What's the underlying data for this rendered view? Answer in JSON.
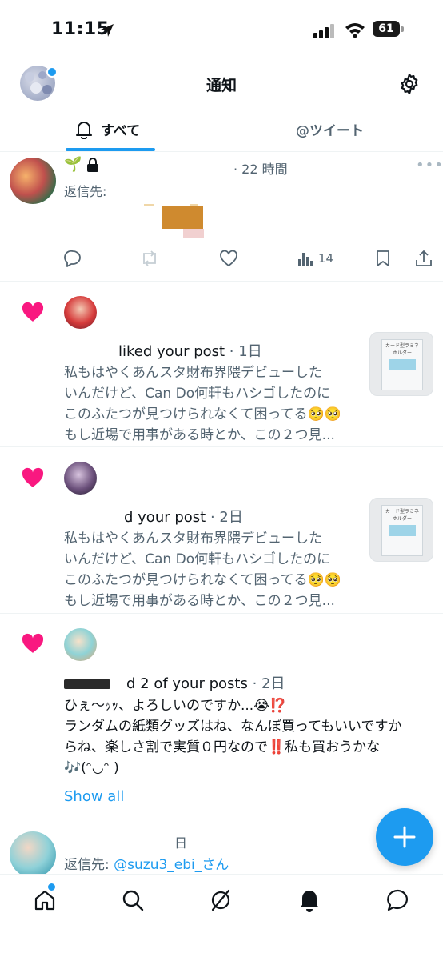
{
  "status_bar": {
    "time": "11:15",
    "battery": "61"
  },
  "header": {
    "title": "通知"
  },
  "tabs": [
    {
      "label": "すべて",
      "active": true
    },
    {
      "label": "@ツイート",
      "active": false
    }
  ],
  "notifications": [
    {
      "type": "reply",
      "time": "· 22 時間",
      "reply_to": "返信先:",
      "views": "14"
    },
    {
      "type": "like",
      "action_text": "liked your post",
      "time": " · 1日",
      "post_lines": [
        "私もはやくあんスタ財布界隈デビューした",
        "いんだけど、Can Do何軒もハシゴしたのに",
        "このふたつが見つけられなくて困ってる🥺🥺",
        "もし近場で用事がある時とか、この２つ見..."
      ],
      "thumb_label": "カード型ラミネホルダー"
    },
    {
      "type": "like",
      "action_text": "d your post",
      "time": " · 2日",
      "post_lines": [
        "私もはやくあんスタ財布界隈デビューした",
        "いんだけど、Can Do何軒もハシゴしたのに",
        "このふたつが見つけられなくて困ってる🥺🥺",
        "もし近場で用事がある時とか、この２つ見..."
      ],
      "thumb_label": "カード型ラミネホルダー"
    },
    {
      "type": "like",
      "action_text": "d 2 of your posts",
      "time": " · 2日",
      "post_lines": [
        "ひぇ〜ｯｯ、よろしいのですか...😭⁉️",
        "ランダムの紙類グッズはね、なんぼ買ってもいいですか",
        "らね、楽しさ割で実質０円なので‼️私も買おうかな",
        "🎶(ᵔ◡ᵔ )"
      ],
      "show_all": "Show all"
    },
    {
      "type": "reply",
      "time": "日",
      "reply_to": "返信先: ",
      "reply_handle": "@suzu3_ebi_さん"
    }
  ],
  "colors": {
    "accent": "#1d9bf0",
    "like": "#f91880",
    "text": "#0f1419",
    "muted": "#536471"
  }
}
